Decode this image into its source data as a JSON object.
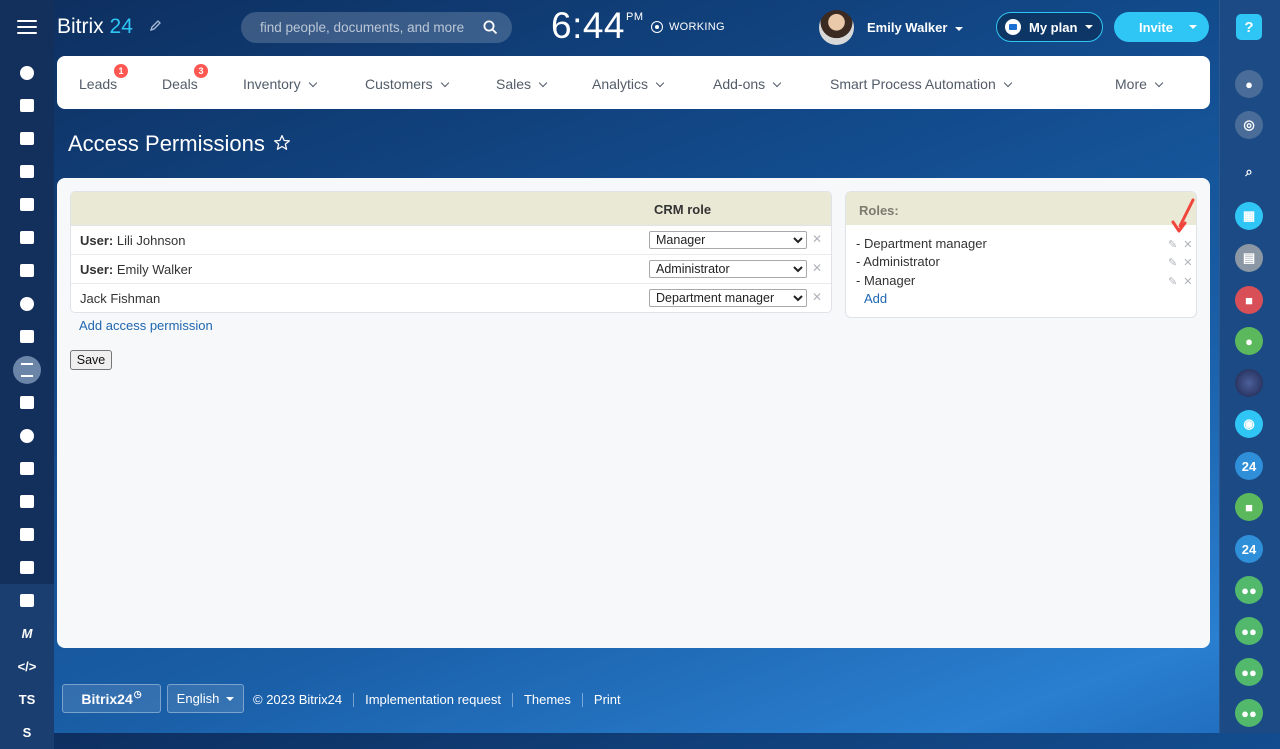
{
  "header": {
    "logo_text": "Bitrix",
    "logo_num": "24",
    "search_placeholder": "find people, documents, and more",
    "clock_time": "6:44",
    "clock_ampm": "PM",
    "work_status": "WORKING",
    "user_name": "Emily Walker",
    "my_plan_label": "My plan",
    "invite_label": "Invite"
  },
  "nav": {
    "items": [
      {
        "label": "Leads",
        "badge": "1"
      },
      {
        "label": "Deals",
        "badge": "3"
      },
      {
        "label": "Inventory"
      },
      {
        "label": "Customers"
      },
      {
        "label": "Sales"
      },
      {
        "label": "Analytics"
      },
      {
        "label": "Add-ons"
      },
      {
        "label": "Smart Process Automation"
      },
      {
        "label": "More"
      }
    ]
  },
  "page": {
    "title": "Access Permissions"
  },
  "permissions": {
    "column_header": "CRM role",
    "rows": [
      {
        "prefix": "User:",
        "name": " Lili Johnson",
        "role": "Manager"
      },
      {
        "prefix": "User:",
        "name": " Emily Walker",
        "role": "Administrator"
      },
      {
        "prefix": "",
        "name": "Jack Fishman",
        "role": "Department manager"
      }
    ],
    "add_label": "Add access permission",
    "save_label": "Save"
  },
  "roles": {
    "header": "Roles:",
    "items": [
      "- Department manager",
      "- Administrator",
      "- Manager"
    ],
    "add_label": "Add"
  },
  "left_sidebar": {
    "text_items": [
      "TS",
      "S"
    ]
  },
  "right_sidebar": {
    "help_label": "?",
    "text_items": [
      "24",
      "24"
    ]
  },
  "footer": {
    "logo": "Bitrix24",
    "language": "English",
    "copyright": "© 2023 Bitrix24",
    "links": [
      "Implementation request",
      "Themes",
      "Print"
    ]
  },
  "colors": {
    "accent": "#2fc6f6",
    "link": "#2067b0",
    "badge": "#ff5752",
    "table_header": "#eae9d5"
  }
}
